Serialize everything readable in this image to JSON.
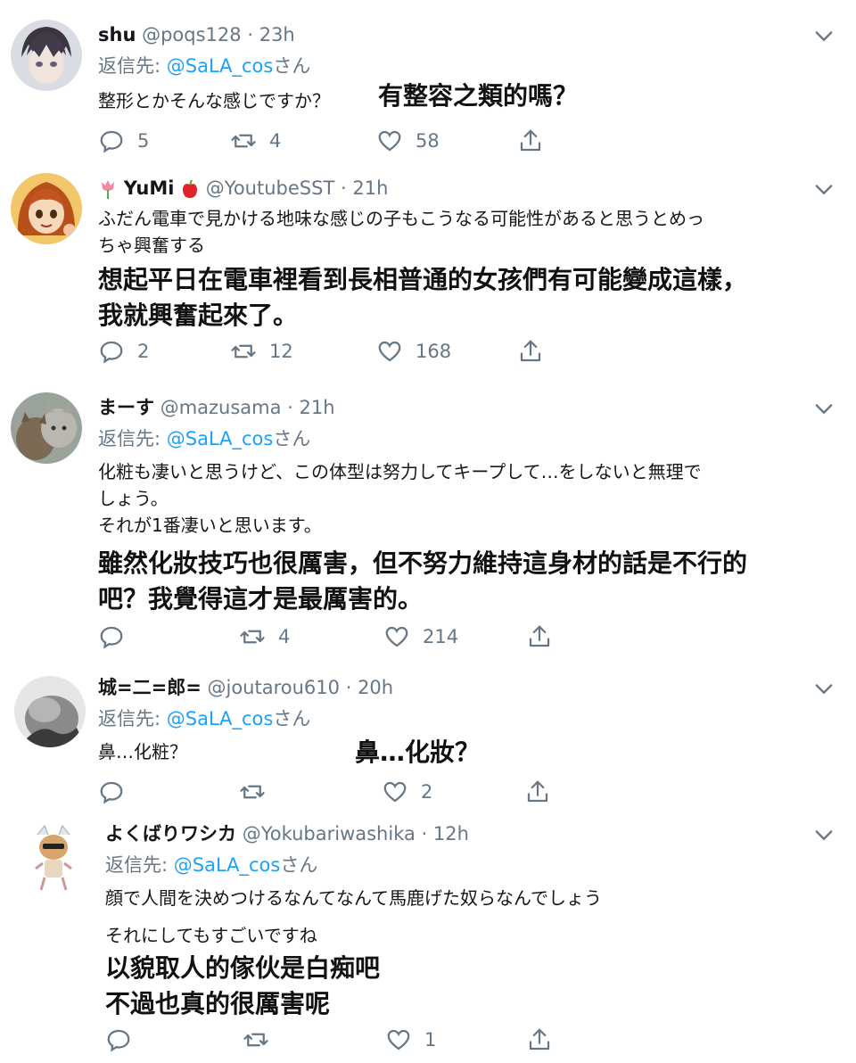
{
  "tweets": [
    {
      "name": "shu",
      "handle": "@poqs128",
      "sep": "·",
      "time": "23h",
      "reply_prefix": "返信先: ",
      "reply_mention": "@SaLA_cos",
      "reply_suffix": "さん",
      "body": [
        "整形とかそんな感じですか？"
      ],
      "translation": [
        "有整容之類的嗎？"
      ],
      "replies": "5",
      "retweets": "4",
      "likes": "58"
    },
    {
      "name": "YuMi",
      "handle": "@YoutubeSST",
      "sep": "·",
      "time": "21h",
      "body": [
        "ふだん電車で見かける地味な感じの子もこうなる可能性があると思うとめっ",
        "ちゃ興奮する"
      ],
      "translation": [
        "想起平日在電車裡看到長相普通的女孩們有可能變成這樣，",
        "我就興奮起來了。"
      ],
      "replies": "2",
      "retweets": "12",
      "likes": "168"
    },
    {
      "name": "まーす",
      "handle": "@mazusama",
      "sep": "·",
      "time": "21h",
      "reply_prefix": "返信先: ",
      "reply_mention": "@SaLA_cos",
      "reply_suffix": "さん",
      "body": [
        "化粧も凄いと思うけど、この体型は努力してキープして…をしないと無理で",
        "しょう。",
        "それが1番凄いと思います。"
      ],
      "translation": [
        "雖然化妝技巧也很厲害，但不努力維持這身材的話是不行的",
        "吧？我覺得這才是最厲害的。"
      ],
      "replies": "",
      "retweets": "4",
      "likes": "214"
    },
    {
      "name": "城=二=郎=",
      "handle": "@joutarou610",
      "sep": "·",
      "time": "20h",
      "reply_prefix": "返信先: ",
      "reply_mention": "@SaLA_cos",
      "reply_suffix": "さん",
      "body": [
        "鼻…化粧？"
      ],
      "translation": [
        "鼻…化妝？"
      ],
      "replies": "",
      "retweets": "",
      "likes": "2"
    },
    {
      "name": "よくばりワシカ",
      "handle": "@Yokubariwashika",
      "sep": "·",
      "time": "12h",
      "reply_prefix": "返信先: ",
      "reply_mention": "@SaLA_cos",
      "reply_suffix": "さん",
      "body": [
        "顔で人間を決めつけるなんてなんて馬鹿げた奴らなんでしょう",
        "それにしてもすごいですね"
      ],
      "translation": [
        "以貌取人的傢伙是白痴吧",
        "不過也真的很厲害呢"
      ],
      "replies": "",
      "retweets": "",
      "likes": "1"
    }
  ],
  "colors": {
    "text": "#14171a",
    "secondary": "#657786",
    "mention": "#1da1f2"
  }
}
